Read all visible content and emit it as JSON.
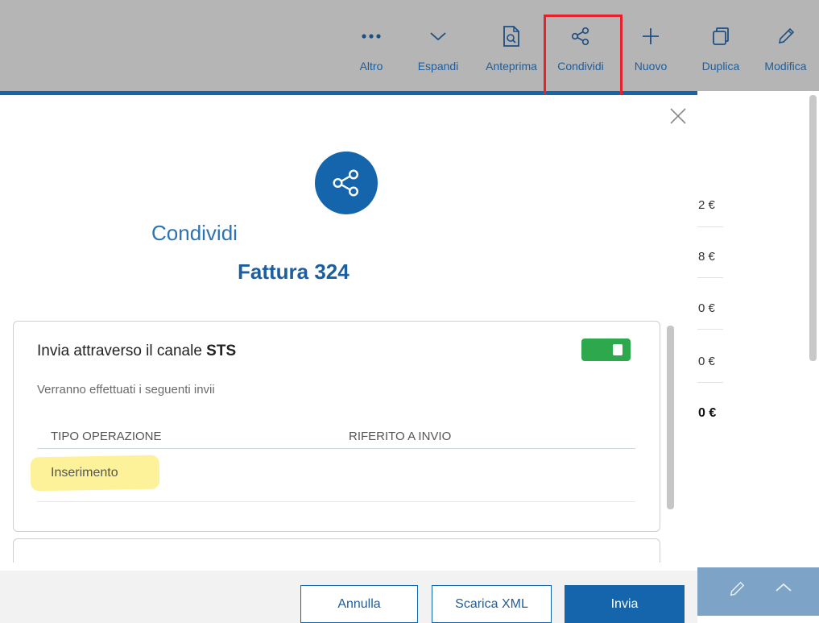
{
  "toolbar": {
    "items": [
      {
        "label": "Altro",
        "icon": "more-dots-icon"
      },
      {
        "label": "Espandi",
        "icon": "chevron-down-icon"
      },
      {
        "label": "Anteprima",
        "icon": "preview-icon"
      },
      {
        "label": "Condividi",
        "icon": "share-icon"
      },
      {
        "label": "Nuovo",
        "icon": "plus-icon"
      },
      {
        "label": "Duplica",
        "icon": "duplicate-icon"
      },
      {
        "label": "Modifica",
        "icon": "pencil-icon"
      }
    ]
  },
  "background": {
    "values": [
      "2 €",
      "8 €",
      "0 €",
      "0 €",
      "0 €"
    ]
  },
  "modal": {
    "title": "Condividi",
    "subtitle": "Fattura 324",
    "card": {
      "heading_prefix": "Invia attraverso il canale ",
      "heading_channel": "STS",
      "toggle_on": true,
      "description": "Verranno effettuati i seguenti invii",
      "columns": [
        "TIPO OPERAZIONE",
        "RIFERITO A INVIO"
      ],
      "rows": [
        {
          "tipo_operazione": "Inserimento",
          "riferito_a_invio": ""
        }
      ]
    },
    "footer": {
      "cancel_label": "Annulla",
      "download_label": "Scarica XML",
      "send_label": "Invia"
    }
  },
  "colors": {
    "primary": "#1565ad",
    "toggle_on": "#2ea84d",
    "highlight": "#fdf19a",
    "annotation_red": "#e8202a"
  }
}
